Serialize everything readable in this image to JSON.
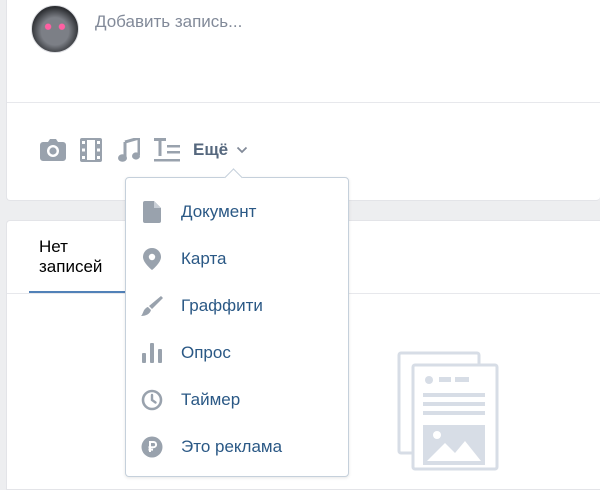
{
  "composer": {
    "placeholder": "Добавить запись...",
    "more_label": "Ещё"
  },
  "feed": {
    "tab_label": "Нет записей"
  },
  "dropdown": {
    "items": [
      {
        "label": "Документ",
        "icon": "document-icon"
      },
      {
        "label": "Карта",
        "icon": "map-pin-icon"
      },
      {
        "label": "Граффити",
        "icon": "brush-icon"
      },
      {
        "label": "Опрос",
        "icon": "poll-icon"
      },
      {
        "label": "Таймер",
        "icon": "clock-icon"
      },
      {
        "label": "Это реклама",
        "icon": "ruble-icon"
      }
    ]
  },
  "colors": {
    "icon": "#99a2ad",
    "link": "#2a5885",
    "accent": "#5181b8",
    "background": "#edeef0"
  }
}
